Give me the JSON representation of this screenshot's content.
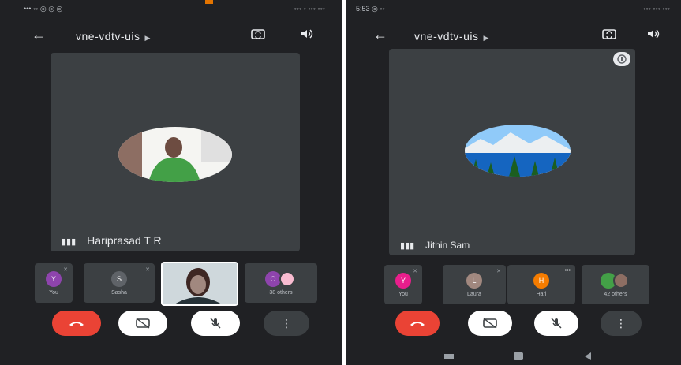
{
  "left": {
    "status_left": "••• ◦◦ ◎ ◎ ◎",
    "status_right": "◦◦◦ ◦ ◦◦◦ ◦◦◦",
    "meeting_code": "vne-vdtv-uis",
    "main_speaker": "Hariprasad T R",
    "participants": [
      {
        "label": "You",
        "initial": "Y",
        "color": "#8e44ad"
      },
      {
        "label": "Sasha",
        "initial": "S",
        "color": "#5f6368"
      },
      {
        "label": "",
        "initial": "",
        "color": "#d7ccc8"
      },
      {
        "label": "38 others",
        "initial": "O",
        "color": "#8e44ad"
      }
    ]
  },
  "right": {
    "status_left": "5:53 ◎ ◦◦",
    "status_right": "◦◦◦ ◦◦◦ ◦◦◦",
    "meeting_code": "vne-vdtv-uis",
    "main_speaker": "Jithin Sam",
    "participants": [
      {
        "label": "You",
        "initial": "Y",
        "color": "#e91e8c"
      },
      {
        "label": "Laura",
        "initial": "L",
        "color": "#a1887f"
      },
      {
        "label": "Hari",
        "initial": "H",
        "color": "#f57c00"
      },
      {
        "label": "42 others",
        "initial": "",
        "color": "#43a047"
      }
    ]
  },
  "colors": {
    "background": "#202124",
    "tile": "#3c4043",
    "end_call": "#ea4335"
  },
  "icons": {
    "back": "back-arrow-icon",
    "switch_camera": "switch-camera-icon",
    "speaker": "speaker-icon",
    "end_call": "end-call-icon",
    "camera": "camera-icon",
    "mic": "mic-icon",
    "more": "more-vertical-icon"
  }
}
